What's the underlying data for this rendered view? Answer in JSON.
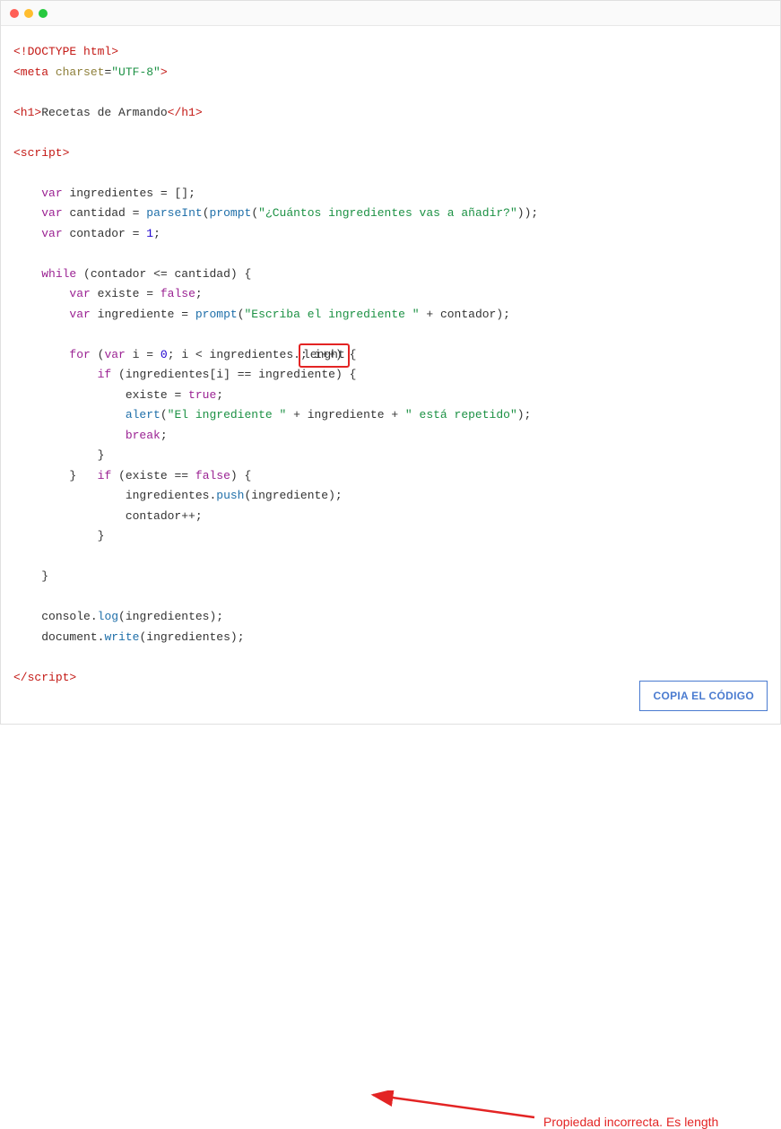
{
  "titlebar": {
    "dots": [
      "red",
      "yellow",
      "green"
    ]
  },
  "code": {
    "doctype": "<!DOCTYPE html>",
    "meta_open": "<meta",
    "meta_attr": " charset",
    "meta_eq": "=",
    "meta_val": "\"UTF-8\"",
    "meta_close": ">",
    "h1_open": "<h1>",
    "h1_text": "Recetas de Armando",
    "h1_close": "</h1>",
    "script_open": "<script>",
    "script_close": "</scr",
    "script_close2": "ipt>",
    "kw_var": "var",
    "kw_while": "while",
    "kw_for": "for",
    "kw_if": "if",
    "kw_break": "break",
    "v_ingredientes": "ingredientes",
    "v_cantidad": "cantidad",
    "v_contador": "contador",
    "v_existe": "existe",
    "v_ingrediente": "ingrediente",
    "v_i": "i",
    "fn_parseInt": "parseInt",
    "fn_prompt": "prompt",
    "fn_alert": "alert",
    "fn_push": "push",
    "fn_log": "log",
    "fn_write": "write",
    "obj_console": "console",
    "obj_document": "document",
    "str_cuantos": "\"¿Cuántos ingredientes vas a añadir?\"",
    "str_escriba": "\"Escriba el ingrediente \"",
    "str_eling": "\"El ingrediente \"",
    "str_repetido": "\" está repetido\"",
    "num_1": "1",
    "num_0": "0",
    "bool_false": "false",
    "bool_true": "true",
    "prop_lenght": "lenght",
    "eq": " = ",
    "empty_arr": "[];",
    "semi": ";",
    "lte": " <= ",
    "lt": " < ",
    "eqeq": " == ",
    "plusplus": "++",
    "plus": " + ",
    "dot": ".",
    "comma": "; ",
    "lparen": "(",
    "rparen": ")",
    "lbrace": " {",
    "rbrace": "}",
    "lbracket": "[",
    "rbracket": "]",
    "rparen_semi": ");",
    "rparen_rparen_semi": "));"
  },
  "annotation": {
    "text": "Propiedad incorrecta. Es length"
  },
  "button": {
    "copy": "COPIA EL CÓDIGO"
  }
}
